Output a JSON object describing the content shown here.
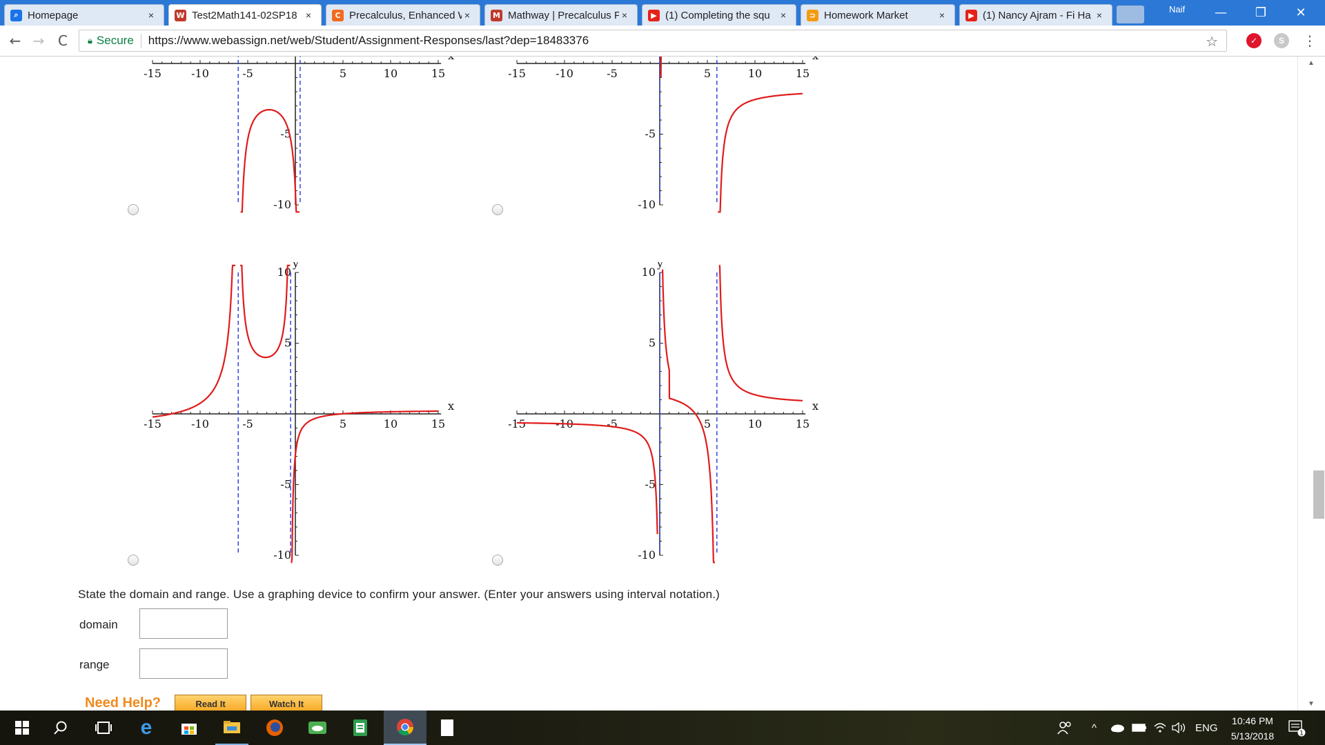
{
  "browser": {
    "tabs": [
      {
        "title": "Homepage",
        "icon": "search-favicon",
        "color": "#1a73e8",
        "active": false
      },
      {
        "title": "Test2Math141-02SP18",
        "icon": "webassign-favicon",
        "color": "#c0392b",
        "active": true
      },
      {
        "title": "Precalculus, Enhanced W",
        "icon": "chegg-favicon",
        "color": "#f26b1d",
        "active": false
      },
      {
        "title": "Mathway | Precalculus P",
        "icon": "mathway-favicon",
        "color": "#c0392b",
        "active": false
      },
      {
        "title": "(1) Completing the squ",
        "icon": "youtube-favicon",
        "color": "#e62117",
        "active": false
      },
      {
        "title": "Homework Market",
        "icon": "homeworkmarket-favicon",
        "color": "#f39c12",
        "active": false
      },
      {
        "title": "(1) Nancy Ajram - Fi Ha",
        "icon": "youtube-favicon",
        "color": "#e62117",
        "active": false
      }
    ],
    "tab_close": "×",
    "profile_name": "Naif",
    "window_controls": {
      "minimize": "—",
      "restore": "❐",
      "close": "✕"
    },
    "nav": {
      "back": "←",
      "forward": "→",
      "reload": "C"
    },
    "secure_label": "Secure",
    "url": "https://www.webassign.net/web/Student/Assignment-Responses/last?dep=18483376",
    "star": "☆",
    "menu": "⋮"
  },
  "graphs": {
    "axis_x": "x",
    "axis_y": "y",
    "x_ticks": [
      "-15",
      "-10",
      "-5",
      "5",
      "10",
      "15"
    ],
    "y_ticks": [
      "5",
      "-5",
      "-10"
    ],
    "y_top_label": "10",
    "curve_color": "#e01b1b",
    "asymptote_color": "#3344dd"
  },
  "question": {
    "prompt": "State the domain and range. Use a graphing device to confirm your answer. (Enter your answers using interval notation.)",
    "domain_label": "domain",
    "range_label": "range",
    "domain_value": "",
    "range_value": ""
  },
  "help": {
    "need_help": "Need Help?",
    "read_it": "Read It",
    "watch_it": "Watch It"
  },
  "taskbar": {
    "apps": [
      "windows-start-icon",
      "search-icon",
      "task-view-icon",
      "edge-icon",
      "store-icon",
      "file-explorer-icon",
      "firefox-icon",
      "cloud-app-icon",
      "notepad-icon",
      "chrome-icon",
      "blank-document-icon"
    ],
    "language": "ENG",
    "time": "10:46 PM",
    "date": "5/13/2018",
    "notification_count": "1"
  }
}
